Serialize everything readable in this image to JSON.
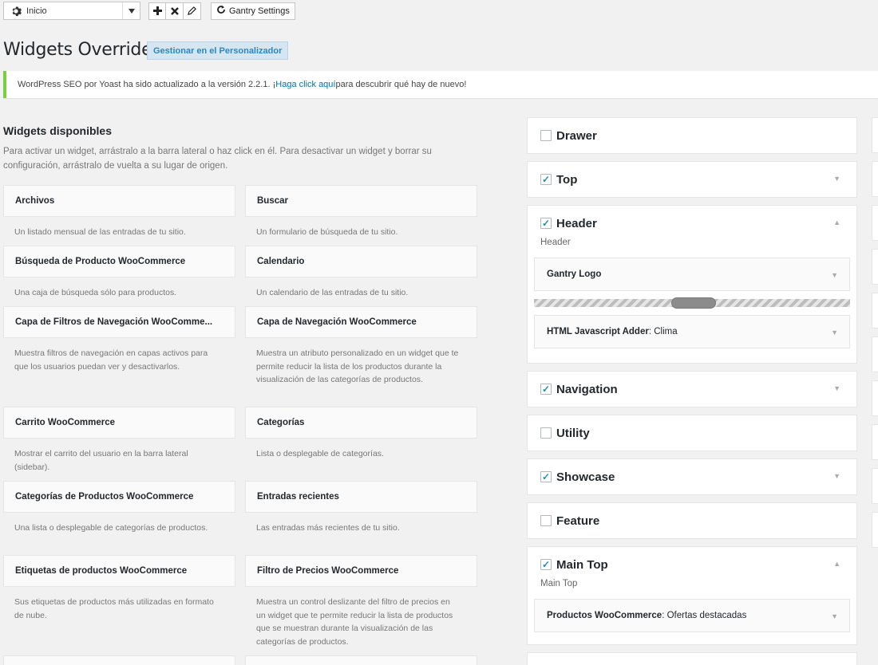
{
  "toolbar": {
    "select_value": "Inicio",
    "gantry_settings": "Gantry Settings"
  },
  "page": {
    "title": "Widgets Override",
    "customizer_button": "Gestionar en el Personalizador"
  },
  "notice": {
    "prefix": "WordPress SEO por Yoast ha sido actualizado a la versión 2.2.1. ¡",
    "link": "Haga click aquí",
    "suffix": " para descubrir qué hay de nuevo!"
  },
  "available": {
    "title": "Widgets disponibles",
    "description": "Para activar un widget, arrástralo a la barra lateral o haz click en él. Para desactivar un widget y borrar su configuración, arrástralo de vuelta a su lugar de origen.",
    "widgets": [
      {
        "title": "Archivos",
        "desc": "Un listado mensual de las entradas de tu sitio."
      },
      {
        "title": "Buscar",
        "desc": "Un formulario de búsqueda de tu sitio."
      },
      {
        "title": "Búsqueda de Producto WooCommerce",
        "desc": "Una caja de búsqueda sólo para productos."
      },
      {
        "title": "Calendario",
        "desc": "Un calendario de las entradas de tu sitio."
      },
      {
        "title": "Capa de Filtros de Navegación WooComme...",
        "desc": "Muestra filtros de navegación en capas activos para que los usuarios puedan ver y desactivarlos."
      },
      {
        "title": "Capa de Navegación WooCommerce",
        "desc": "Muestra un atributo personalizado en un widget que te permite reducir la lista de los productos durante la visualización de las categorías de productos."
      },
      {
        "title": "Carrito WooCommerce",
        "desc": "Mostrar el carrito del usuario en la barra lateral (sidebar)."
      },
      {
        "title": "Categorías",
        "desc": "Lista o desplegable de categorías."
      },
      {
        "title": "Categorías de Productos WooCommerce",
        "desc": "Una lista o desplegable de categorías de productos."
      },
      {
        "title": "Entradas recientes",
        "desc": "Las entradas más recientes de tu sitio."
      },
      {
        "title": "Etiquetas de productos WooCommerce",
        "desc": "Sus etiquetas de productos más utilizadas en formato de nube."
      },
      {
        "title": "Filtro de Precios WooCommerce",
        "desc": "Muestra un control deslizante del filtro de precios en un widget que te permite reducir la lista de productos que se muestran durante la visualización de las categorías de productos."
      }
    ]
  },
  "sidebars": [
    {
      "name": "Drawer",
      "checked": false
    },
    {
      "name": "Top",
      "checked": true
    },
    {
      "name": "Header",
      "checked": true,
      "desc": "Header",
      "widgets": [
        {
          "title": "Gantry Logo",
          "sub": ""
        },
        {
          "title": "HTML Javascript Adder",
          "sub": ": Clima"
        }
      ]
    },
    {
      "name": "Navigation",
      "checked": true
    },
    {
      "name": "Utility",
      "checked": false
    },
    {
      "name": "Showcase",
      "checked": true
    },
    {
      "name": "Feature",
      "checked": false
    },
    {
      "name": "Main Top",
      "checked": true,
      "desc": "Main Top",
      "widgets": [
        {
          "title": "Productos WooCommerce",
          "sub": ": Ofertas destacadas"
        }
      ]
    }
  ]
}
